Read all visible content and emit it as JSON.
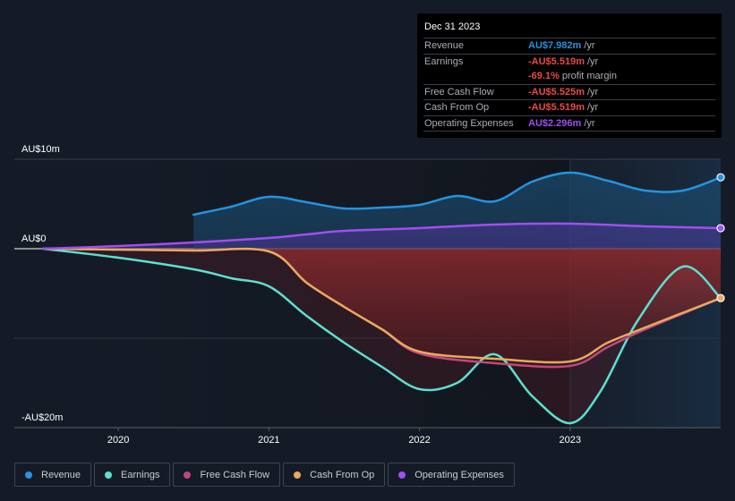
{
  "tooltip": {
    "date": "Dec 31 2023",
    "rows": [
      {
        "label": "Revenue",
        "value": "AU$7.982m",
        "unit": "/yr",
        "color": "#2394df"
      },
      {
        "label": "Earnings",
        "value": "-AU$5.519m",
        "unit": "/yr",
        "color": "#e84a4a"
      },
      {
        "label": "",
        "value": "-69.1%",
        "unit": "profit margin",
        "color": "#e84a4a"
      },
      {
        "label": "Free Cash Flow",
        "value": "-AU$5.525m",
        "unit": "/yr",
        "color": "#e84a4a"
      },
      {
        "label": "Cash From Op",
        "value": "-AU$5.519m",
        "unit": "/yr",
        "color": "#e84a4a"
      },
      {
        "label": "Operating Expenses",
        "value": "AU$2.296m",
        "unit": "/yr",
        "color": "#a04ff0"
      }
    ]
  },
  "legend": [
    {
      "label": "Revenue",
      "color": "#2394df"
    },
    {
      "label": "Earnings",
      "color": "#5ce0d0"
    },
    {
      "label": "Free Cash Flow",
      "color": "#c2477e"
    },
    {
      "label": "Cash From Op",
      "color": "#e8aa5c"
    },
    {
      "label": "Operating Expenses",
      "color": "#a04ff0"
    }
  ],
  "chart_data": {
    "type": "area",
    "title": "",
    "xlabel": "",
    "ylabel": "",
    "unit": "AU$m",
    "ylim": [
      -20,
      10
    ],
    "xlim": [
      2019.5,
      2024.0
    ],
    "y_ticks": [
      {
        "value": 10,
        "label": "AU$10m"
      },
      {
        "value": 0,
        "label": "AU$0"
      },
      {
        "value": -20,
        "label": "-AU$20m"
      }
    ],
    "x_ticks": [
      {
        "value": 2020,
        "label": "2020"
      },
      {
        "value": 2021,
        "label": "2021"
      },
      {
        "value": 2022,
        "label": "2022"
      },
      {
        "value": 2023,
        "label": "2023"
      }
    ],
    "highlight_x": 2023.0,
    "grid": true,
    "legend_position": "bottom",
    "series": [
      {
        "name": "Revenue",
        "color": "#2394df",
        "x": [
          2020.5,
          2020.75,
          2021.0,
          2021.25,
          2021.5,
          2021.75,
          2022.0,
          2022.25,
          2022.5,
          2022.75,
          2023.0,
          2023.25,
          2023.5,
          2023.75,
          2024.0
        ],
        "values": [
          3.8,
          4.7,
          5.8,
          5.2,
          4.5,
          4.6,
          4.9,
          5.9,
          5.3,
          7.5,
          8.5,
          7.6,
          6.5,
          6.5,
          7.982
        ]
      },
      {
        "name": "Operating Expenses",
        "color": "#a04ff0",
        "x": [
          2019.5,
          2020.0,
          2020.5,
          2021.0,
          2021.25,
          2021.5,
          2022.0,
          2022.5,
          2023.0,
          2023.5,
          2024.0
        ],
        "values": [
          0.0,
          0.3,
          0.7,
          1.2,
          1.6,
          2.0,
          2.3,
          2.7,
          2.8,
          2.5,
          2.296
        ]
      },
      {
        "name": "Earnings",
        "color": "#5ce0d0",
        "x": [
          2019.5,
          2020.0,
          2020.5,
          2020.75,
          2021.0,
          2021.25,
          2021.5,
          2021.75,
          2022.0,
          2022.25,
          2022.5,
          2022.75,
          2023.0,
          2023.2,
          2023.45,
          2023.75,
          2024.0
        ],
        "values": [
          0.0,
          -1.0,
          -2.3,
          -3.3,
          -4.2,
          -7.5,
          -10.5,
          -13.2,
          -15.7,
          -15.0,
          -11.8,
          -16.5,
          -19.5,
          -16.0,
          -8.0,
          -2.0,
          -5.519
        ]
      },
      {
        "name": "Cash From Op",
        "color": "#e8aa5c",
        "x": [
          2019.5,
          2020.0,
          2020.5,
          2021.0,
          2021.25,
          2021.5,
          2021.75,
          2022.0,
          2022.5,
          2023.0,
          2023.25,
          2023.5,
          2024.0
        ],
        "values": [
          0.0,
          -0.1,
          -0.2,
          -0.3,
          -3.8,
          -6.5,
          -9.0,
          -11.5,
          -12.3,
          -12.6,
          -10.5,
          -8.8,
          -5.519
        ]
      },
      {
        "name": "Free Cash Flow",
        "color": "#c2477e",
        "x": [
          2019.5,
          2020.0,
          2020.5,
          2021.0,
          2021.25,
          2021.5,
          2021.75,
          2022.0,
          2022.5,
          2023.0,
          2023.25,
          2023.5,
          2024.0
        ],
        "values": [
          0.0,
          -0.1,
          -0.2,
          -0.3,
          -3.8,
          -6.5,
          -9.0,
          -11.7,
          -12.8,
          -13.1,
          -11.0,
          -9.0,
          -5.525
        ]
      }
    ]
  }
}
